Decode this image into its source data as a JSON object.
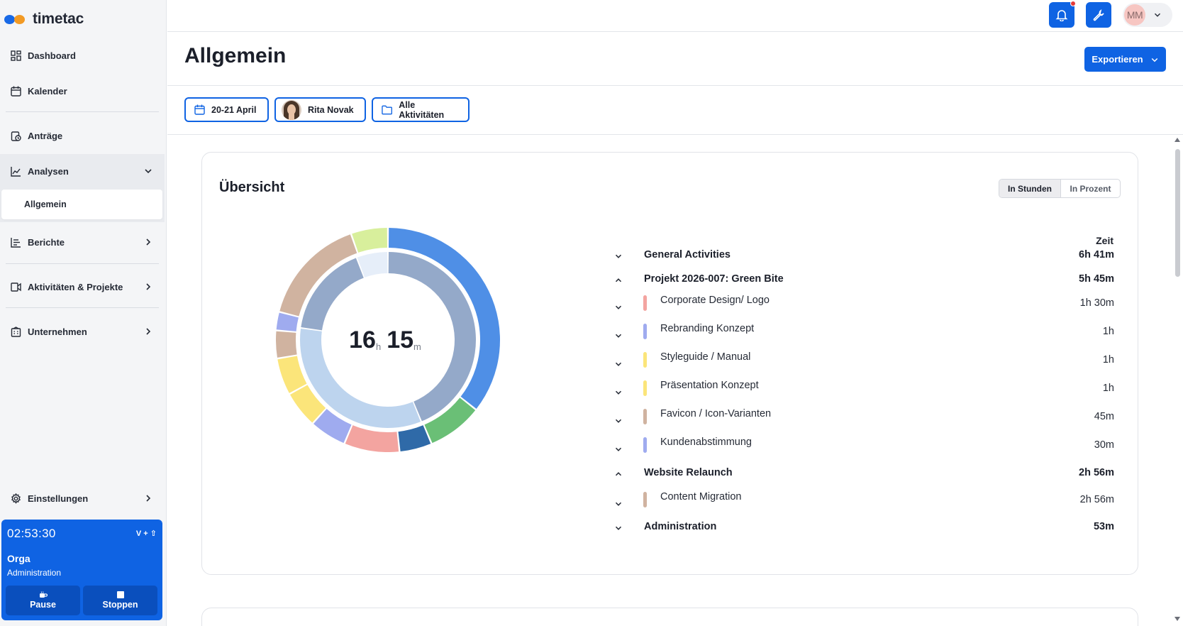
{
  "app": {
    "logo_text": "timetac"
  },
  "sidebar": {
    "items": [
      {
        "label": "Dashboard",
        "icon": "dashboard-icon"
      },
      {
        "label": "Kalender",
        "icon": "calendar-icon"
      },
      {
        "label": "Anträge",
        "icon": "requests-icon"
      },
      {
        "label": "Analysen",
        "icon": "chart-line-icon",
        "expanded": true
      },
      {
        "label": "Allgemein",
        "active": true
      },
      {
        "label": "Berichte",
        "icon": "reports-icon"
      },
      {
        "label": "Aktivitäten & Projekte",
        "icon": "projects-icon"
      },
      {
        "label": "Unternehmen",
        "icon": "company-icon"
      },
      {
        "label": "Einstellungen",
        "icon": "gear-icon"
      }
    ]
  },
  "timer": {
    "time": "02:53:30",
    "shortcut": "V + ⇧",
    "project": "Orga",
    "task": "Administration",
    "pause_label": "Pause",
    "stop_label": "Stoppen"
  },
  "topbar": {
    "user_initials": "MM"
  },
  "header": {
    "title": "Allgemein",
    "export_label": "Exportieren"
  },
  "filters": {
    "date": "20-21 April",
    "user": "Rita Novak",
    "activities": "Alle Aktivitäten"
  },
  "overview": {
    "title": "Übersicht",
    "toggle_hours": "In Stunden",
    "toggle_percent": "In Prozent",
    "total_hours": "16",
    "total_hours_unit": "h",
    "total_minutes": "15",
    "total_minutes_unit": "m",
    "time_header": "Zeit",
    "rows": [
      {
        "name": "General Activities",
        "value": "6h 41m",
        "level": 0,
        "expanded": false
      },
      {
        "name": "Projekt 2026-007: Green Bite",
        "value": "5h 45m",
        "level": 0,
        "expanded": true
      },
      {
        "name": "Corporate Design/ Logo",
        "value": "1h 30m",
        "level": 1,
        "color": "#f3a4a0"
      },
      {
        "name": "Rebranding Konzept",
        "value": "1h",
        "level": 1,
        "color": "#9fabef"
      },
      {
        "name": "Styleguide / Manual",
        "value": "1h",
        "level": 1,
        "color": "#fbe57a"
      },
      {
        "name": "Präsentation Konzept",
        "value": "1h",
        "level": 1,
        "color": "#fbe57a"
      },
      {
        "name": "Favicon / Icon-Varianten",
        "value": "45m",
        "level": 1,
        "color": "#d0b3a0"
      },
      {
        "name": "Kundenabstimmung",
        "value": "30m",
        "level": 1,
        "color": "#9fabef"
      },
      {
        "name": "Website Relaunch",
        "value": "2h 56m",
        "level": 0,
        "expanded": true
      },
      {
        "name": "Content Migration",
        "value": "2h 56m",
        "level": 1,
        "color": "#d0b3a0"
      },
      {
        "name": "Administration",
        "value": "53m",
        "level": 0,
        "expanded": false
      }
    ]
  },
  "chart_data": {
    "type": "pie",
    "rings": [
      {
        "name": "outer",
        "segments": [
          {
            "value": 6.68,
            "color": "#4f8fe6"
          },
          {
            "value": 1.5,
            "color": "#6abf76"
          },
          {
            "value": 0.88,
            "color": "#2f6aa8"
          },
          {
            "value": 1.5,
            "color": "#f3a4a0"
          },
          {
            "value": 1.0,
            "color": "#9fabef"
          },
          {
            "value": 1.0,
            "color": "#fbe57a"
          },
          {
            "value": 1.0,
            "color": "#fbe57a"
          },
          {
            "value": 0.75,
            "color": "#d0b3a0"
          },
          {
            "value": 0.5,
            "color": "#9fabef"
          },
          {
            "value": 2.93,
            "color": "#d0b3a0"
          },
          {
            "value": 1.0,
            "color": "#d8ef9c"
          }
        ]
      },
      {
        "name": "inner",
        "segments": [
          {
            "value": 7.55,
            "color": "#94a9c9"
          },
          {
            "value": 5.75,
            "color": "#bdd4ee"
          },
          {
            "value": 2.93,
            "color": "#94a9c9"
          },
          {
            "value": 1.0,
            "color": "#e6eef9"
          }
        ]
      }
    ]
  }
}
